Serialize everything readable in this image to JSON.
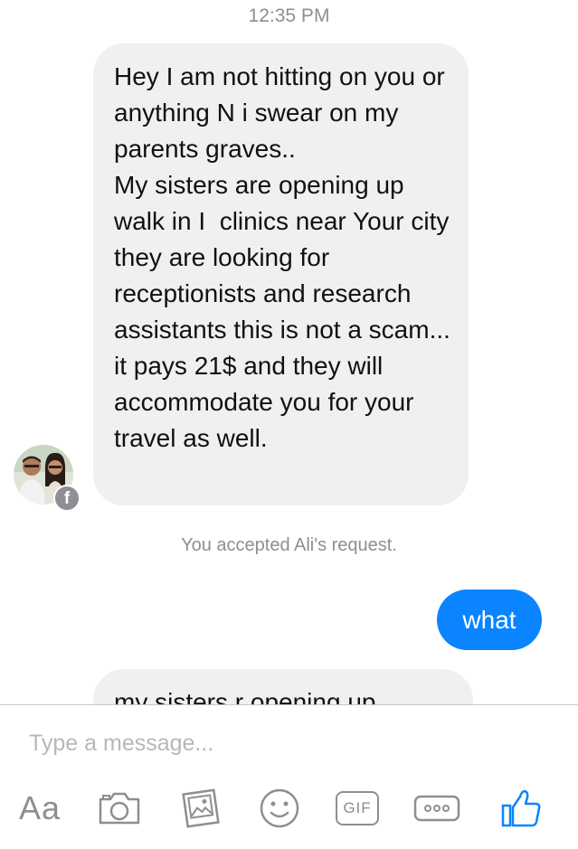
{
  "header": {
    "time": "12:35 PM"
  },
  "messages": {
    "incoming_1": "Hey I am not hitting on you or anything N i swear on my parents graves..\nMy sisters are opening up walk in I  clinics near Your city they are looking for receptionists and research assistants this is not a scam...\nit pays 21$ and they will accommodate you for your travel as well.",
    "system": "You accepted Ali's request.",
    "outgoing_1": "what",
    "incoming_2_partial": "my sisters r opening up"
  },
  "composer": {
    "placeholder": "Type a message...",
    "aa_label": "Aa",
    "gif_label": "GIF"
  },
  "colors": {
    "outgoing_bubble": "#0a84ff",
    "incoming_bubble": "#f0f0f0",
    "icon_gray": "#8e8e93",
    "like_blue": "#0a84ff"
  },
  "icons": {
    "toolbar": [
      "text-format-icon",
      "camera-icon",
      "photo-gallery-icon",
      "emoji-icon",
      "gif-icon",
      "more-icon",
      "thumbs-up-icon"
    ]
  }
}
